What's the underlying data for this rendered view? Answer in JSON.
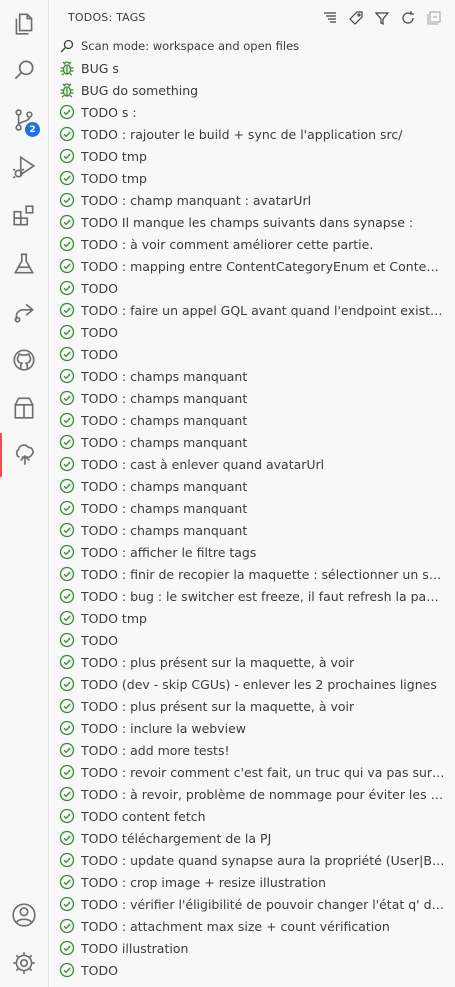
{
  "activity_bar": {
    "items": [
      {
        "name": "explorer-icon"
      },
      {
        "name": "search-icon"
      },
      {
        "name": "source-control-icon",
        "badge": "2"
      },
      {
        "name": "run-debug-icon"
      },
      {
        "name": "extensions-icon"
      },
      {
        "name": "testing-icon"
      },
      {
        "name": "remote-share-icon"
      },
      {
        "name": "github-icon"
      },
      {
        "name": "containers-icon"
      },
      {
        "name": "todo-tree-icon"
      }
    ],
    "bottom": [
      {
        "name": "account-icon"
      },
      {
        "name": "settings-gear-icon"
      }
    ],
    "accent": "#f14c4c",
    "badge_color": "#1a73e8"
  },
  "sidebar": {
    "title": "TODOS: TAGS",
    "actions": [
      "expand-tree-icon",
      "tag-icon",
      "filter-icon",
      "refresh-icon",
      "collapse-all-icon"
    ],
    "scan_mode": "Scan mode: workspace and open files",
    "bug_color": "#388a34",
    "check_color": "#388a34",
    "items": [
      {
        "kind": "bug",
        "text": "BUG s"
      },
      {
        "kind": "bug",
        "text": "BUG do something"
      },
      {
        "kind": "todo",
        "text": "TODO s :"
      },
      {
        "kind": "todo",
        "text": "TODO : rajouter le build + sync de l'application src/"
      },
      {
        "kind": "todo",
        "text": "TODO tmp"
      },
      {
        "kind": "todo",
        "text": "TODO tmp"
      },
      {
        "kind": "todo",
        "text": "TODO : champ manquant : avatarUrl"
      },
      {
        "kind": "todo",
        "text": "TODO Il manque les champs suivants dans synapse :"
      },
      {
        "kind": "todo",
        "text": "TODO : à voir comment améliorer cette partie."
      },
      {
        "kind": "todo",
        "text": "TODO : mapping entre ContentCategoryEnum et ContentCat..."
      },
      {
        "kind": "todo",
        "text": "TODO"
      },
      {
        "kind": "todo",
        "text": "TODO : faire un appel GQL avant quand l'endpoint existera"
      },
      {
        "kind": "todo",
        "text": "TODO"
      },
      {
        "kind": "todo",
        "text": "TODO"
      },
      {
        "kind": "todo",
        "text": "TODO : champs manquant"
      },
      {
        "kind": "todo",
        "text": "TODO : champs manquant"
      },
      {
        "kind": "todo",
        "text": "TODO : champs manquant"
      },
      {
        "kind": "todo",
        "text": "TODO : champs manquant"
      },
      {
        "kind": "todo",
        "text": "TODO : cast à enlever quand avatarUrl"
      },
      {
        "kind": "todo",
        "text": "TODO : champs manquant"
      },
      {
        "kind": "todo",
        "text": "TODO : champs manquant"
      },
      {
        "kind": "todo",
        "text": "TODO : champs manquant"
      },
      {
        "kind": "todo",
        "text": "TODO : afficher le filtre tags"
      },
      {
        "kind": "todo",
        "text": "TODO : finir de recopier la maquette : sélectionner un sujet p..."
      },
      {
        "kind": "todo",
        "text": "TODO : bug : le switcher est freeze, il faut refresh la page pou..."
      },
      {
        "kind": "todo",
        "text": "TODO tmp"
      },
      {
        "kind": "todo",
        "text": "TODO"
      },
      {
        "kind": "todo",
        "text": "TODO : plus présent sur la maquette, à voir"
      },
      {
        "kind": "todo",
        "text": "TODO (dev - skip CGUs) - enlever les 2 prochaines lignes"
      },
      {
        "kind": "todo",
        "text": "TODO : plus présent sur la maquette, à voir"
      },
      {
        "kind": "todo",
        "text": "TODO : inclure la webview"
      },
      {
        "kind": "todo",
        "text": "TODO : add more tests!"
      },
      {
        "kind": "todo",
        "text": "TODO : revoir comment c'est fait, un truc qui va pas sur com..."
      },
      {
        "kind": "todo",
        "text": "TODO : à revoir, problème de nommage pour éviter les conflits"
      },
      {
        "kind": "todo",
        "text": "TODO content fetch"
      },
      {
        "kind": "todo",
        "text": "TODO téléchargement de la PJ"
      },
      {
        "kind": "todo",
        "text": "TODO : update quand synapse aura la propriété (User|Benefic..."
      },
      {
        "kind": "todo",
        "text": "TODO : crop image + resize illustration"
      },
      {
        "kind": "todo",
        "text": "TODO : vérifier l'éligibilité de pouvoir changer l'état q' d'un c..."
      },
      {
        "kind": "todo",
        "text": "TODO : attachment max size + count vérification"
      },
      {
        "kind": "todo",
        "text": "TODO illustration"
      },
      {
        "kind": "todo",
        "text": "TODO"
      }
    ]
  }
}
